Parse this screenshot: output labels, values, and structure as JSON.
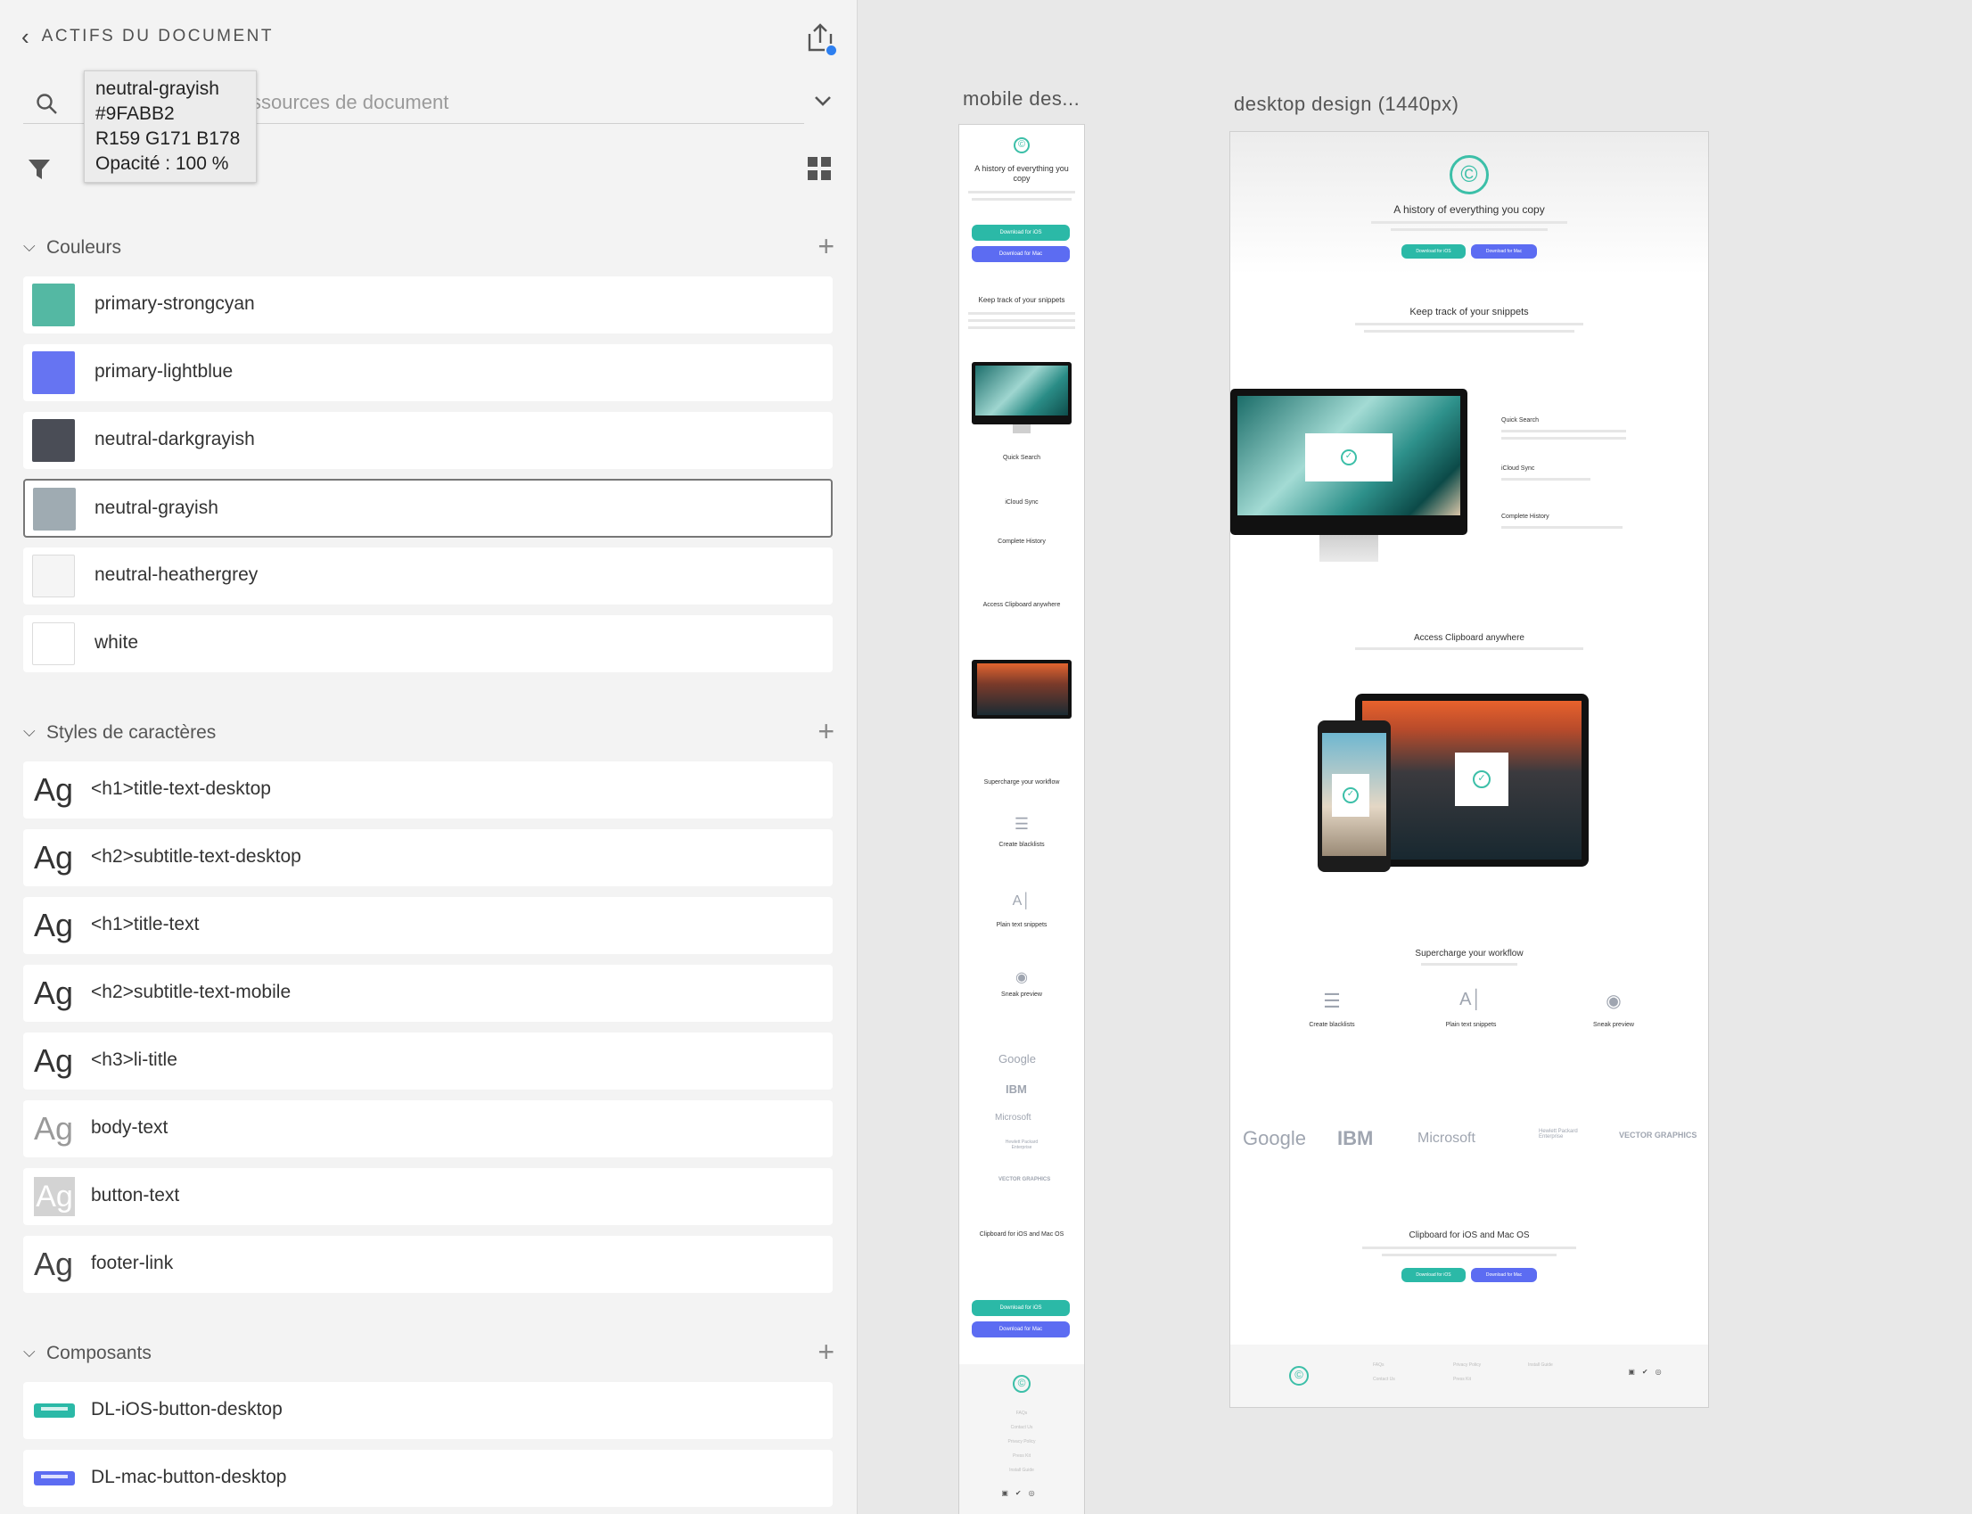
{
  "panel": {
    "title": "ACTIFS DU DOCUMENT",
    "search_placeholder": "ssources de document",
    "tooltip": {
      "name": "neutral-grayish",
      "hex": "#9FABB2",
      "rgb": "R159 G171 B178",
      "opacity": "Opacité : 100 %"
    },
    "sections": {
      "colors": "Couleurs",
      "char_styles": "Styles de caractères",
      "components": "Composants"
    },
    "colors": [
      {
        "name": "primary-strongcyan",
        "hex": "#54b8a3"
      },
      {
        "name": "primary-lightblue",
        "hex": "#6674f2"
      },
      {
        "name": "neutral-darkgrayish",
        "hex": "#4a4d56"
      },
      {
        "name": "neutral-grayish",
        "hex": "#9fabb2"
      },
      {
        "name": "neutral-heathergrey",
        "hex": "#f5f5f5"
      },
      {
        "name": "white",
        "hex": "#ffffff"
      }
    ],
    "char_styles": [
      {
        "ag": "Ag",
        "name": "<h1>title-text-desktop"
      },
      {
        "ag": "Ag",
        "name": "<h2>subtitle-text-desktop"
      },
      {
        "ag": "Ag",
        "name": "<h1>title-text"
      },
      {
        "ag": "Ag",
        "name": "<h2>subtitle-text-mobile"
      },
      {
        "ag": "Ag",
        "name": "<h3>li-title"
      },
      {
        "ag": "Ag",
        "name": "body-text"
      },
      {
        "ag": "Ag",
        "name": "button-text"
      },
      {
        "ag": "Ag",
        "name": "footer-link"
      }
    ],
    "components": [
      {
        "name": "DL-iOS-button-desktop",
        "color": "#2bb9a7"
      },
      {
        "name": "DL-mac-button-desktop",
        "color": "#5c6cf2"
      }
    ]
  },
  "artboards": {
    "mobile": {
      "label": "mobile des...",
      "hero_title": "A history of everything you copy",
      "btn_ios": "Download for iOS",
      "btn_mac": "Download for Mac",
      "snippets_title": "Keep track of your snippets",
      "features": [
        "Quick Search",
        "iCloud Sync",
        "Complete History"
      ],
      "access_title": "Access Clipboard anywhere",
      "workflow_title": "Supercharge your workflow",
      "workflow_items": [
        "Create blacklists",
        "Plain text snippets",
        "Sneak preview"
      ],
      "brands": [
        "Google",
        "IBM",
        "Microsoft",
        "Hewlett Packard Enterprise",
        "VECTOR GRAPHICS"
      ],
      "cta_title": "Clipboard for iOS and Mac OS",
      "footer_links": [
        "FAQs",
        "Contact Us",
        "Privacy Policy",
        "Press Kit",
        "Install Guide"
      ]
    },
    "desktop": {
      "label": "desktop design (1440px)",
      "hero_title": "A history of everything you copy",
      "btn_ios": "Download for iOS",
      "btn_mac": "Download for Mac",
      "snippets_title": "Keep track of your snippets",
      "features": [
        "Quick Search",
        "iCloud Sync",
        "Complete History"
      ],
      "access_title": "Access Clipboard anywhere",
      "workflow_title": "Supercharge your workflow",
      "workflow_items": [
        "Create blacklists",
        "Plain text snippets",
        "Sneak preview"
      ],
      "brands": [
        "Google",
        "IBM",
        "Microsoft",
        "Hewlett Packard Enterprise",
        "VECTOR GRAPHICS"
      ],
      "cta_title": "Clipboard for iOS and Mac OS",
      "footer_links": [
        "FAQs",
        "Contact Us",
        "Privacy Policy",
        "Press Kit",
        "Install Guide"
      ]
    }
  }
}
